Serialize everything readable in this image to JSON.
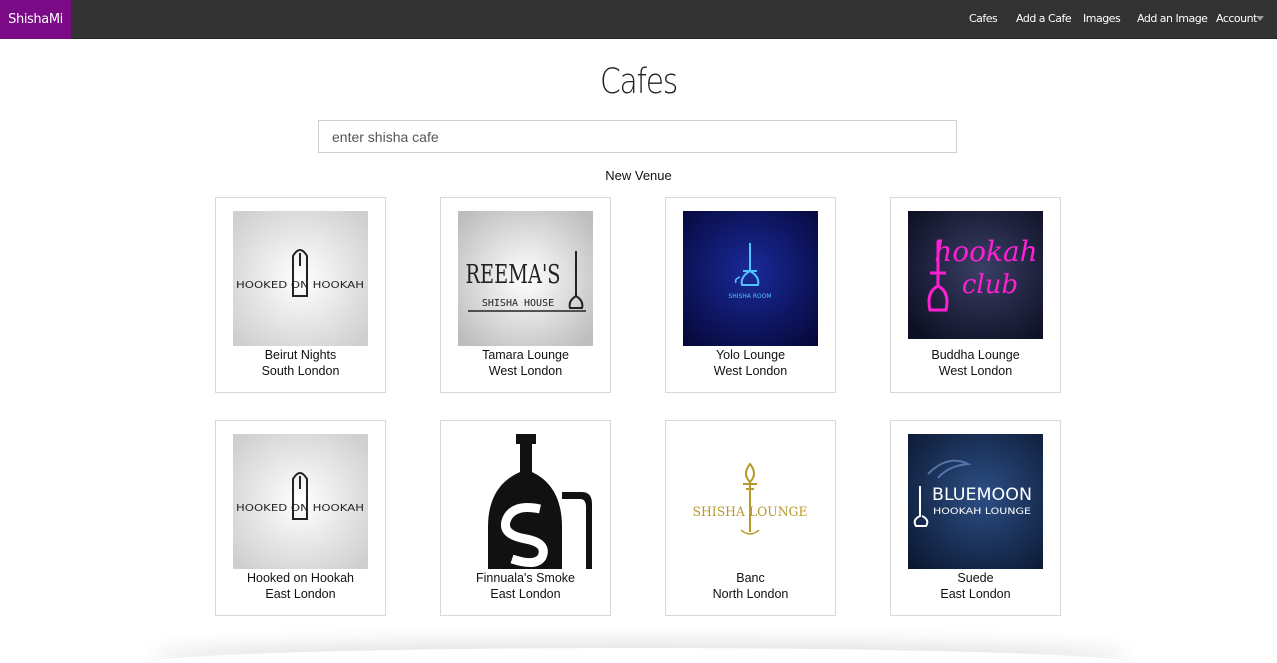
{
  "nav": {
    "brand": "ShishaMi",
    "links": [
      "Cafes",
      "Add a Cafe",
      "Images",
      "Add an Image",
      "Account"
    ]
  },
  "page": {
    "title": "Cafes",
    "search_placeholder": "enter shisha cafe",
    "new_venue_label": "New Venue"
  },
  "cafes": [
    {
      "name": "Beirut Nights",
      "area": "South London",
      "logo": "hooked-on-hookah-logo"
    },
    {
      "name": "Tamara Lounge",
      "area": "West London",
      "logo": "reema-shisha-house-logo"
    },
    {
      "name": "Yolo Lounge",
      "area": "West London",
      "logo": "shisha-room-logo"
    },
    {
      "name": "Buddha Lounge",
      "area": "West London",
      "logo": "hookah-club-logo"
    },
    {
      "name": "Hooked on Hookah",
      "area": "East London",
      "logo": "hooked-on-hookah-logo"
    },
    {
      "name": "Finnuala's Smoke",
      "area": "East London",
      "logo": "hookah-s-logo"
    },
    {
      "name": "Banc",
      "area": "North London",
      "logo": "shisha-lounge-logo"
    },
    {
      "name": "Suede",
      "area": "East London",
      "logo": "bluemoon-hookah-lounge-logo"
    }
  ],
  "logo_text": {
    "hooked": "HOOKED ON HOOKAH",
    "reema": "REEMA'S",
    "shisha_house": "SHISHA HOUSE",
    "shisha_room": "SHISHA ROOM",
    "hookah_club_1": "hookah",
    "hookah_club_2": "club",
    "shisha_lounge": "SHISHA LOUNGE",
    "bluemoon_1": "BLUEMOON",
    "bluemoon_2": "HOOKAH LOUNGE"
  },
  "colors": {
    "navbar": "#333333",
    "brand": "#7b0a86"
  }
}
